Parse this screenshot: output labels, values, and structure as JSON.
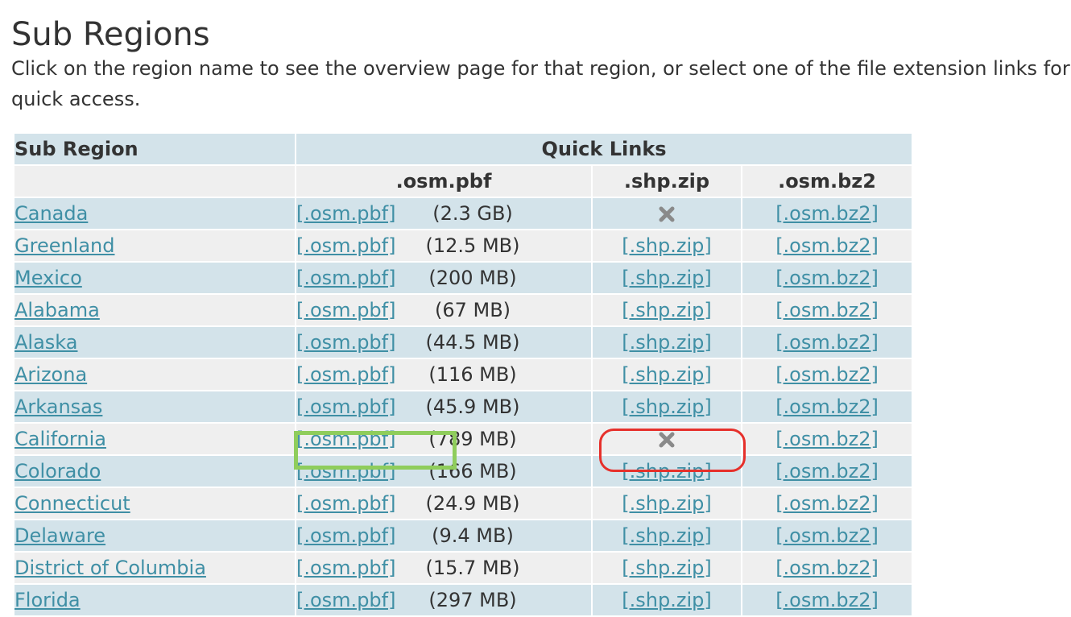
{
  "page": {
    "title": "Sub Regions",
    "intro": "Click on the region name to see the overview page for that region, or select one of the file extension links for quick access."
  },
  "table": {
    "headers": {
      "sub_region": "Sub Region",
      "quick_links": "Quick Links",
      "pbf": ".osm.pbf",
      "shp": ".shp.zip",
      "bz2": ".osm.bz2"
    },
    "link_labels": {
      "pbf": "[.osm.pbf]",
      "shp": "[.shp.zip]",
      "bz2": "[.osm.bz2]"
    },
    "unavailable_icon": "x-icon",
    "rows": [
      {
        "name": "Canada",
        "size": "(2.3 GB)",
        "shp_available": false
      },
      {
        "name": "Greenland",
        "size": "(12.5 MB)",
        "shp_available": true
      },
      {
        "name": "Mexico",
        "size": "(200 MB)",
        "shp_available": true
      },
      {
        "name": "Alabama",
        "size": "(67 MB)",
        "shp_available": true
      },
      {
        "name": "Alaska",
        "size": "(44.5 MB)",
        "shp_available": true
      },
      {
        "name": "Arizona",
        "size": "(116 MB)",
        "shp_available": true
      },
      {
        "name": "Arkansas",
        "size": "(45.9 MB)",
        "shp_available": true
      },
      {
        "name": "California",
        "size": "(789 MB)",
        "shp_available": false
      },
      {
        "name": "Colorado",
        "size": "(166 MB)",
        "shp_available": true
      },
      {
        "name": "Connecticut",
        "size": "(24.9 MB)",
        "shp_available": true
      },
      {
        "name": "Delaware",
        "size": "(9.4 MB)",
        "shp_available": true
      },
      {
        "name": "District of Columbia",
        "size": "(15.7 MB)",
        "shp_available": true
      },
      {
        "name": "Florida",
        "size": "(297 MB)",
        "shp_available": true
      }
    ]
  },
  "annotations": {
    "green_box_color": "#8fcd5c",
    "red_box_color": "#e6302b"
  }
}
